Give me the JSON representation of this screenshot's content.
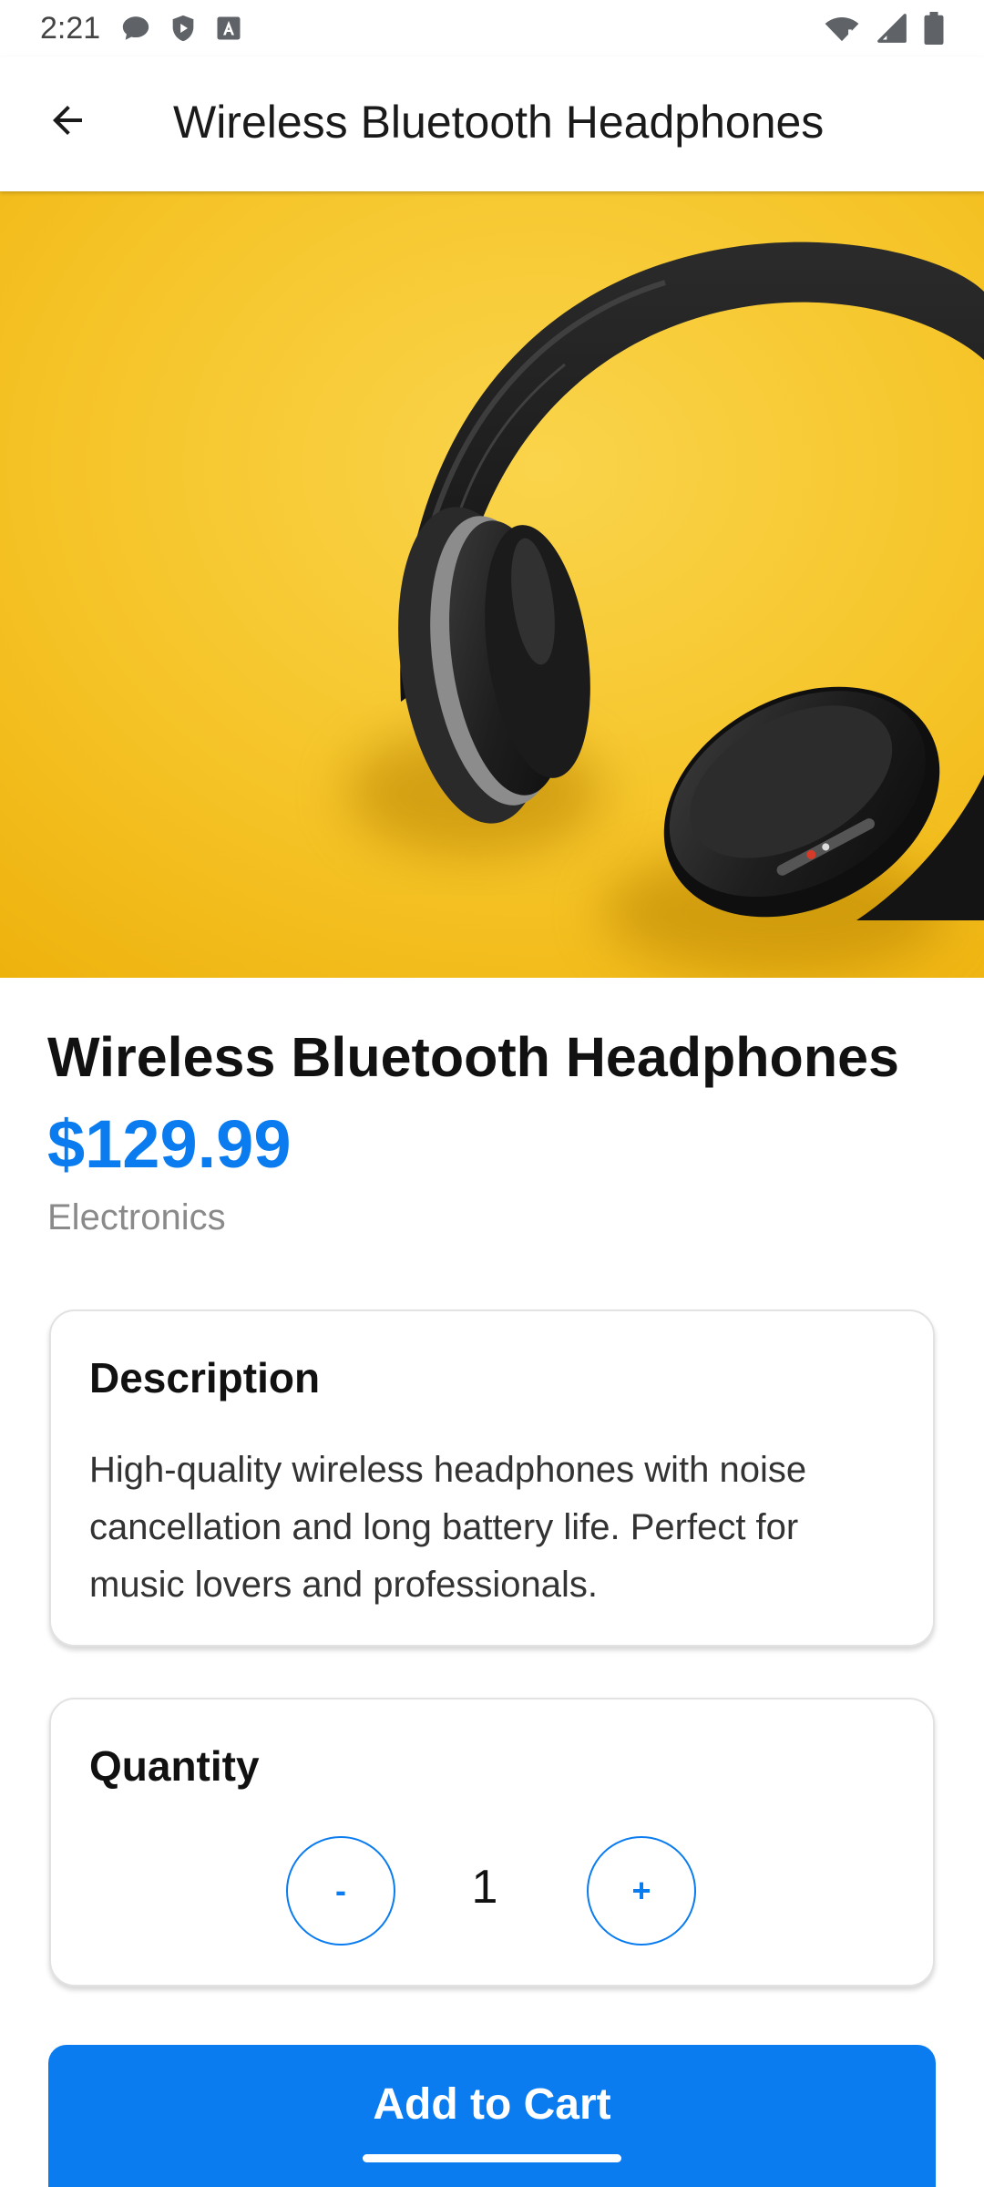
{
  "status_bar": {
    "time": "2:21",
    "icons": [
      "chat-bubble-icon",
      "shield-play-icon",
      "font-a-icon",
      "wifi-icon",
      "signal-icon",
      "battery-icon"
    ]
  },
  "app_bar": {
    "title": "Wireless Bluetooth Headphones",
    "back_icon": "arrow-left-icon"
  },
  "product": {
    "image": "headphones-photo",
    "title": "Wireless Bluetooth Headphones",
    "price": "$129.99",
    "category": "Electronics"
  },
  "description": {
    "heading": "Description",
    "text": "High-quality wireless headphones with noise cancellation and long battery life. Perfect for music lovers and professionals."
  },
  "quantity": {
    "heading": "Quantity",
    "minus_label": "-",
    "value": "1",
    "plus_label": "+"
  },
  "cart": {
    "button_label": "Add to Cart"
  },
  "colors": {
    "accent": "#0a7cf0",
    "hero_background": "#f5c326",
    "muted_text": "#8a8a8a"
  }
}
